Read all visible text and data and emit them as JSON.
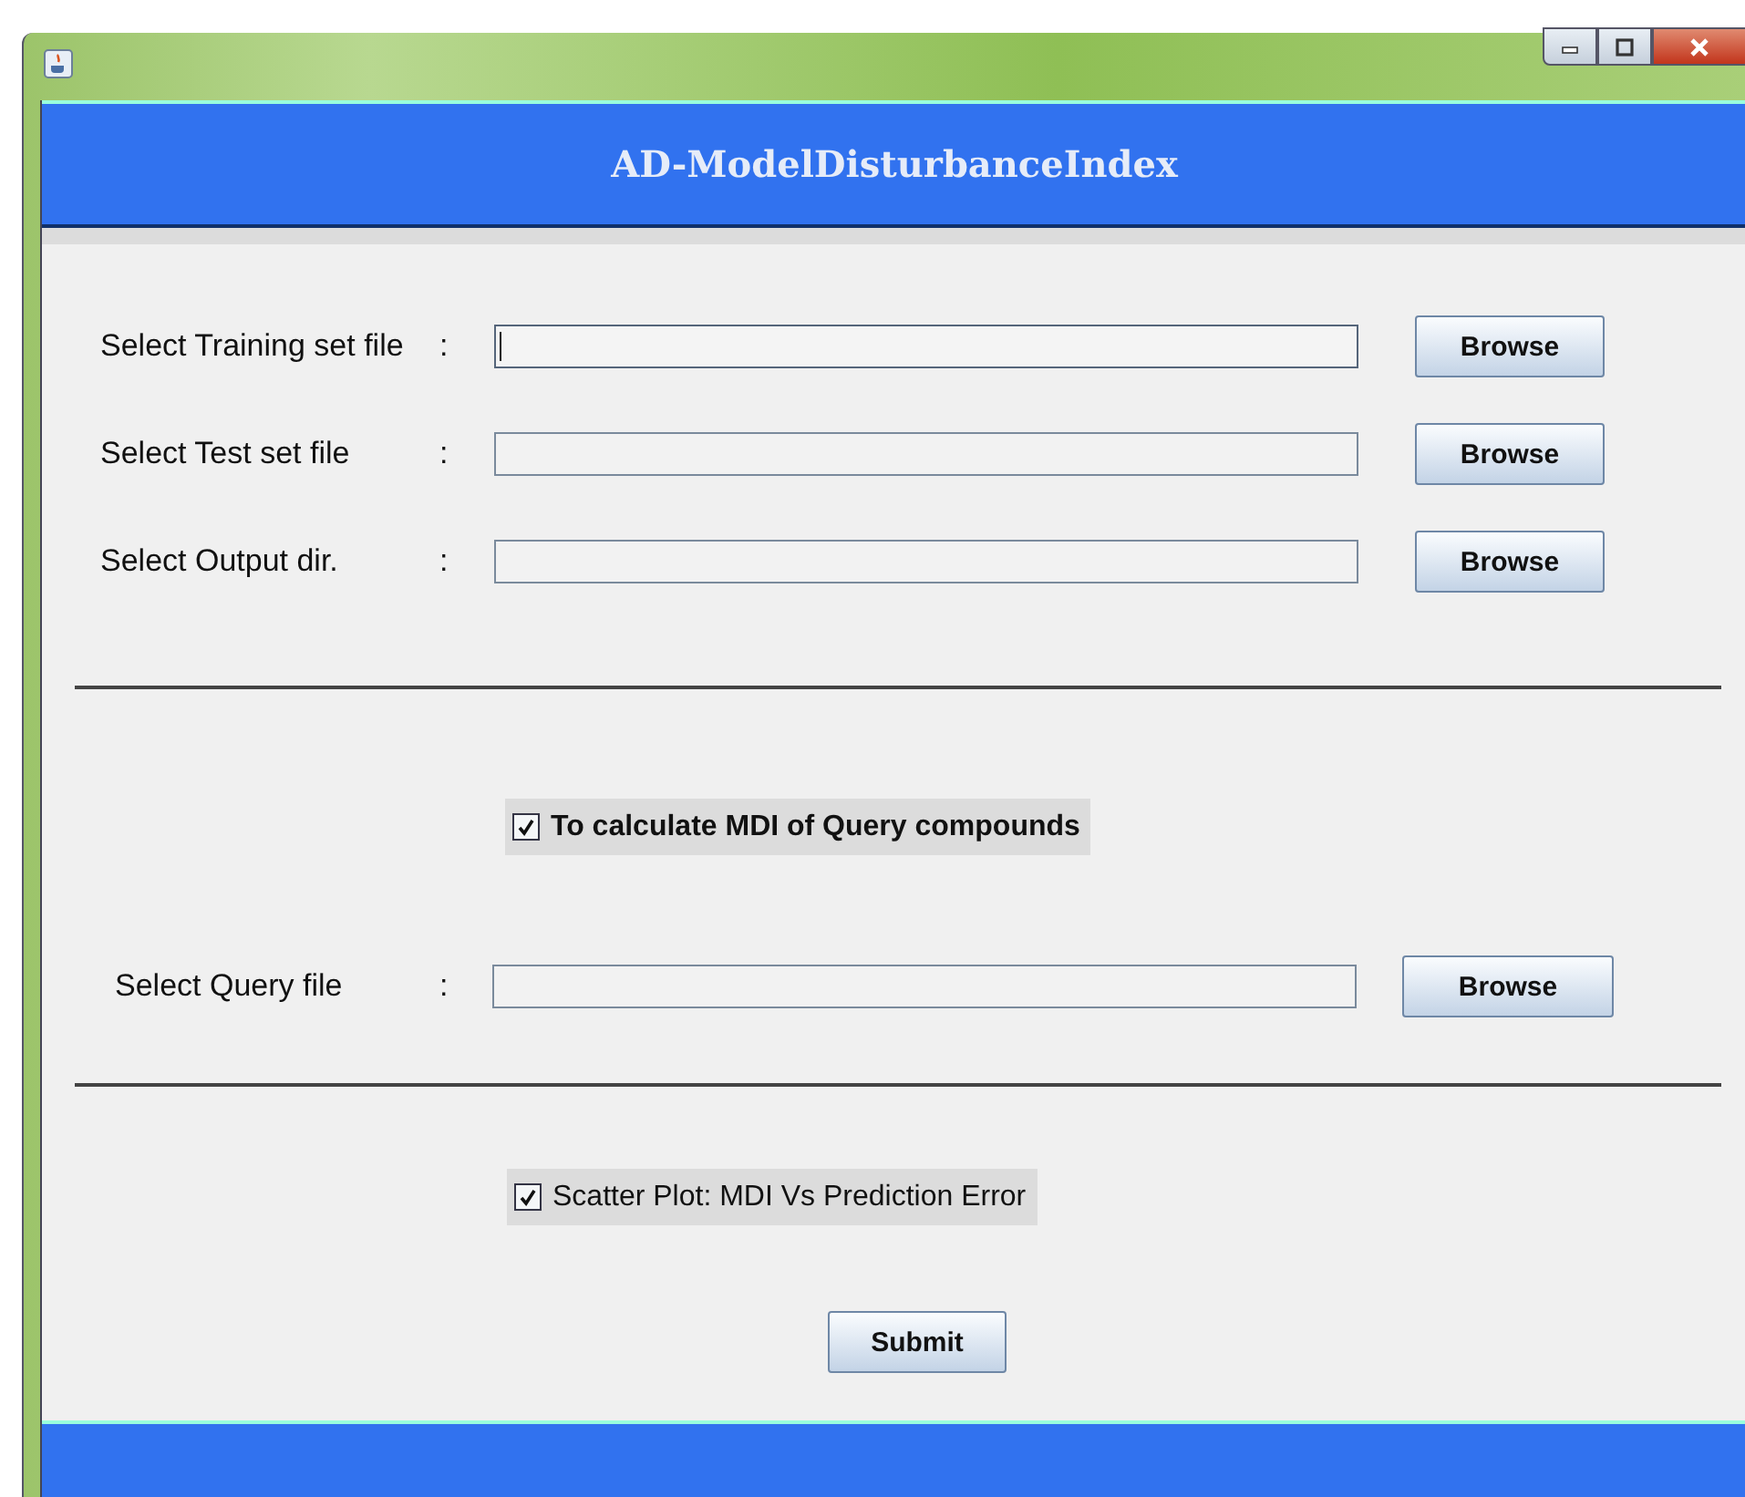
{
  "window": {
    "title_bar_buttons": [
      {
        "kind": "minimize"
      },
      {
        "kind": "maximize"
      },
      {
        "kind": "close"
      }
    ]
  },
  "header": {
    "title": "AD-ModelDisturbanceIndex"
  },
  "file_rows": [
    {
      "label": "Select Training set file",
      "colon": ":",
      "button": "Browse",
      "focused": true
    },
    {
      "label": "Select Test set file",
      "colon": ":",
      "button": "Browse",
      "focused": false
    },
    {
      "label": "Select Output dir.",
      "colon": ":",
      "button": "Browse",
      "focused": false
    }
  ],
  "query_option": {
    "label": "To calculate MDI of Query compounds",
    "checked": true
  },
  "query_row": {
    "label": "Select Query file",
    "colon": ":",
    "button": "Browse"
  },
  "plot_option": {
    "label": "Scatter Plot: MDI Vs Prediction Error",
    "checked": true
  },
  "submit": "Submit"
}
